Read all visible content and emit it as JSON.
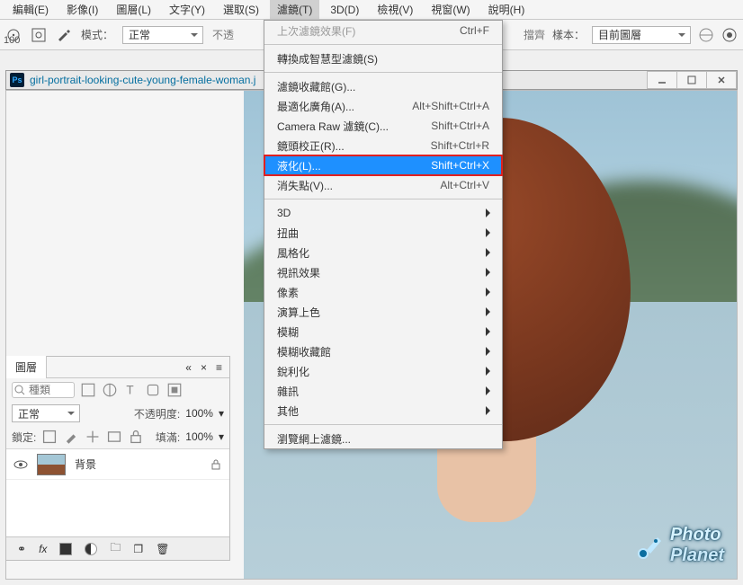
{
  "menubar": {
    "items": [
      "編輯(E)",
      "影像(I)",
      "圖層(L)",
      "文字(Y)",
      "選取(S)",
      "濾鏡(T)",
      "3D(D)",
      "檢視(V)",
      "視窗(W)",
      "說明(H)"
    ],
    "openIndex": 5
  },
  "optbar": {
    "num": "100",
    "mode_label": "模式：",
    "mode_value": "正常",
    "truncated": "不透",
    "align_label": "樣本：",
    "align_value": "目前圖層",
    "hidden_word": "擋齊"
  },
  "doc": {
    "title": "girl-portrait-looking-cute-young-female-woman.j"
  },
  "filterMenu": {
    "items": [
      {
        "label": "上次濾鏡效果(F)",
        "shortcut": "Ctrl+F",
        "disabled": true
      },
      {
        "sep": true
      },
      {
        "label": "轉換成智慧型濾鏡(S)"
      },
      {
        "sep": true
      },
      {
        "label": "濾鏡收藏館(G)..."
      },
      {
        "label": "最適化廣角(A)...",
        "shortcut": "Alt+Shift+Ctrl+A"
      },
      {
        "label": "Camera Raw 濾鏡(C)...",
        "shortcut": "Shift+Ctrl+A"
      },
      {
        "label": "鏡頭校正(R)...",
        "shortcut": "Shift+Ctrl+R"
      },
      {
        "label": "液化(L)...",
        "shortcut": "Shift+Ctrl+X",
        "hl": true
      },
      {
        "label": "消失點(V)...",
        "shortcut": "Alt+Ctrl+V"
      },
      {
        "sep": true
      },
      {
        "label": "3D",
        "sub": true
      },
      {
        "label": "扭曲",
        "sub": true
      },
      {
        "label": "風格化",
        "sub": true
      },
      {
        "label": "視訊效果",
        "sub": true
      },
      {
        "label": "像素",
        "sub": true
      },
      {
        "label": "演算上色",
        "sub": true
      },
      {
        "label": "模糊",
        "sub": true
      },
      {
        "label": "模糊收藏館",
        "sub": true
      },
      {
        "label": "銳利化",
        "sub": true
      },
      {
        "label": "雜訊",
        "sub": true
      },
      {
        "label": "其他",
        "sub": true
      },
      {
        "sep": true
      },
      {
        "label": "瀏覽網上濾鏡..."
      }
    ]
  },
  "layers": {
    "tab": "圖層",
    "kind_placeholder": "種類",
    "blend": "正常",
    "opacity_label": "不透明度:",
    "opacity_val": "100%",
    "lock_label": "鎖定:",
    "fill_label": "填滿:",
    "fill_val": "100%",
    "layer_name": "背景"
  },
  "watermark": {
    "line1": "Photo",
    "line2": "Planet"
  }
}
